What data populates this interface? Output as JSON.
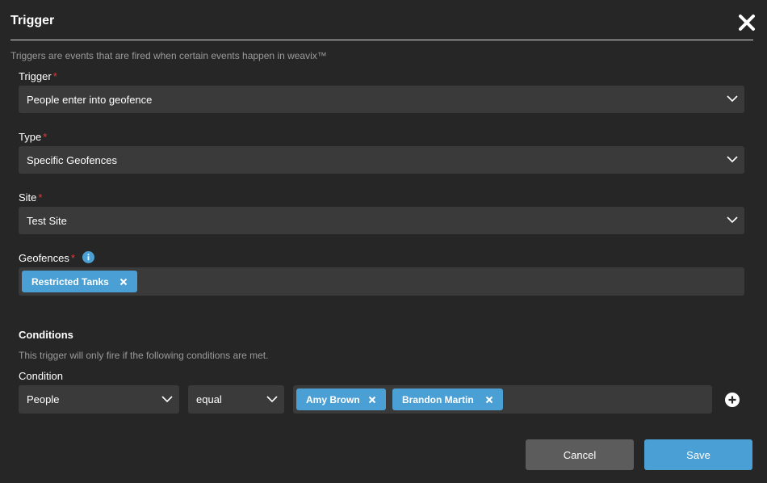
{
  "dialog": {
    "title": "Trigger",
    "description": "Triggers are events that are fired when certain events happen in weavix™"
  },
  "fields": {
    "trigger": {
      "label": "Trigger",
      "required": "*",
      "value": "People enter into geofence"
    },
    "type": {
      "label": "Type",
      "required": "*",
      "value": "Specific Geofences"
    },
    "site": {
      "label": "Site",
      "required": "*",
      "value": "Test Site"
    },
    "geofences": {
      "label": "Geofences",
      "required": "*",
      "tags": [
        "Restricted Tanks"
      ]
    }
  },
  "conditions": {
    "heading": "Conditions",
    "note": "This trigger will only fire if the following conditions are met.",
    "condition_label": "Condition",
    "field_value": "People",
    "operator_value": "equal",
    "value_tags": [
      "Amy Brown",
      "Brandon Martin"
    ]
  },
  "buttons": {
    "cancel": "Cancel",
    "save": "Save"
  },
  "colors": {
    "background": "#262626",
    "input": "#3a3a3a",
    "accent": "#4a9fd4",
    "required": "#e23b3b",
    "cancel": "#5c5c5c"
  },
  "icons": [
    "close-icon",
    "chevron-down-icon",
    "info-icon",
    "tag-remove-icon",
    "add-condition-icon"
  ]
}
